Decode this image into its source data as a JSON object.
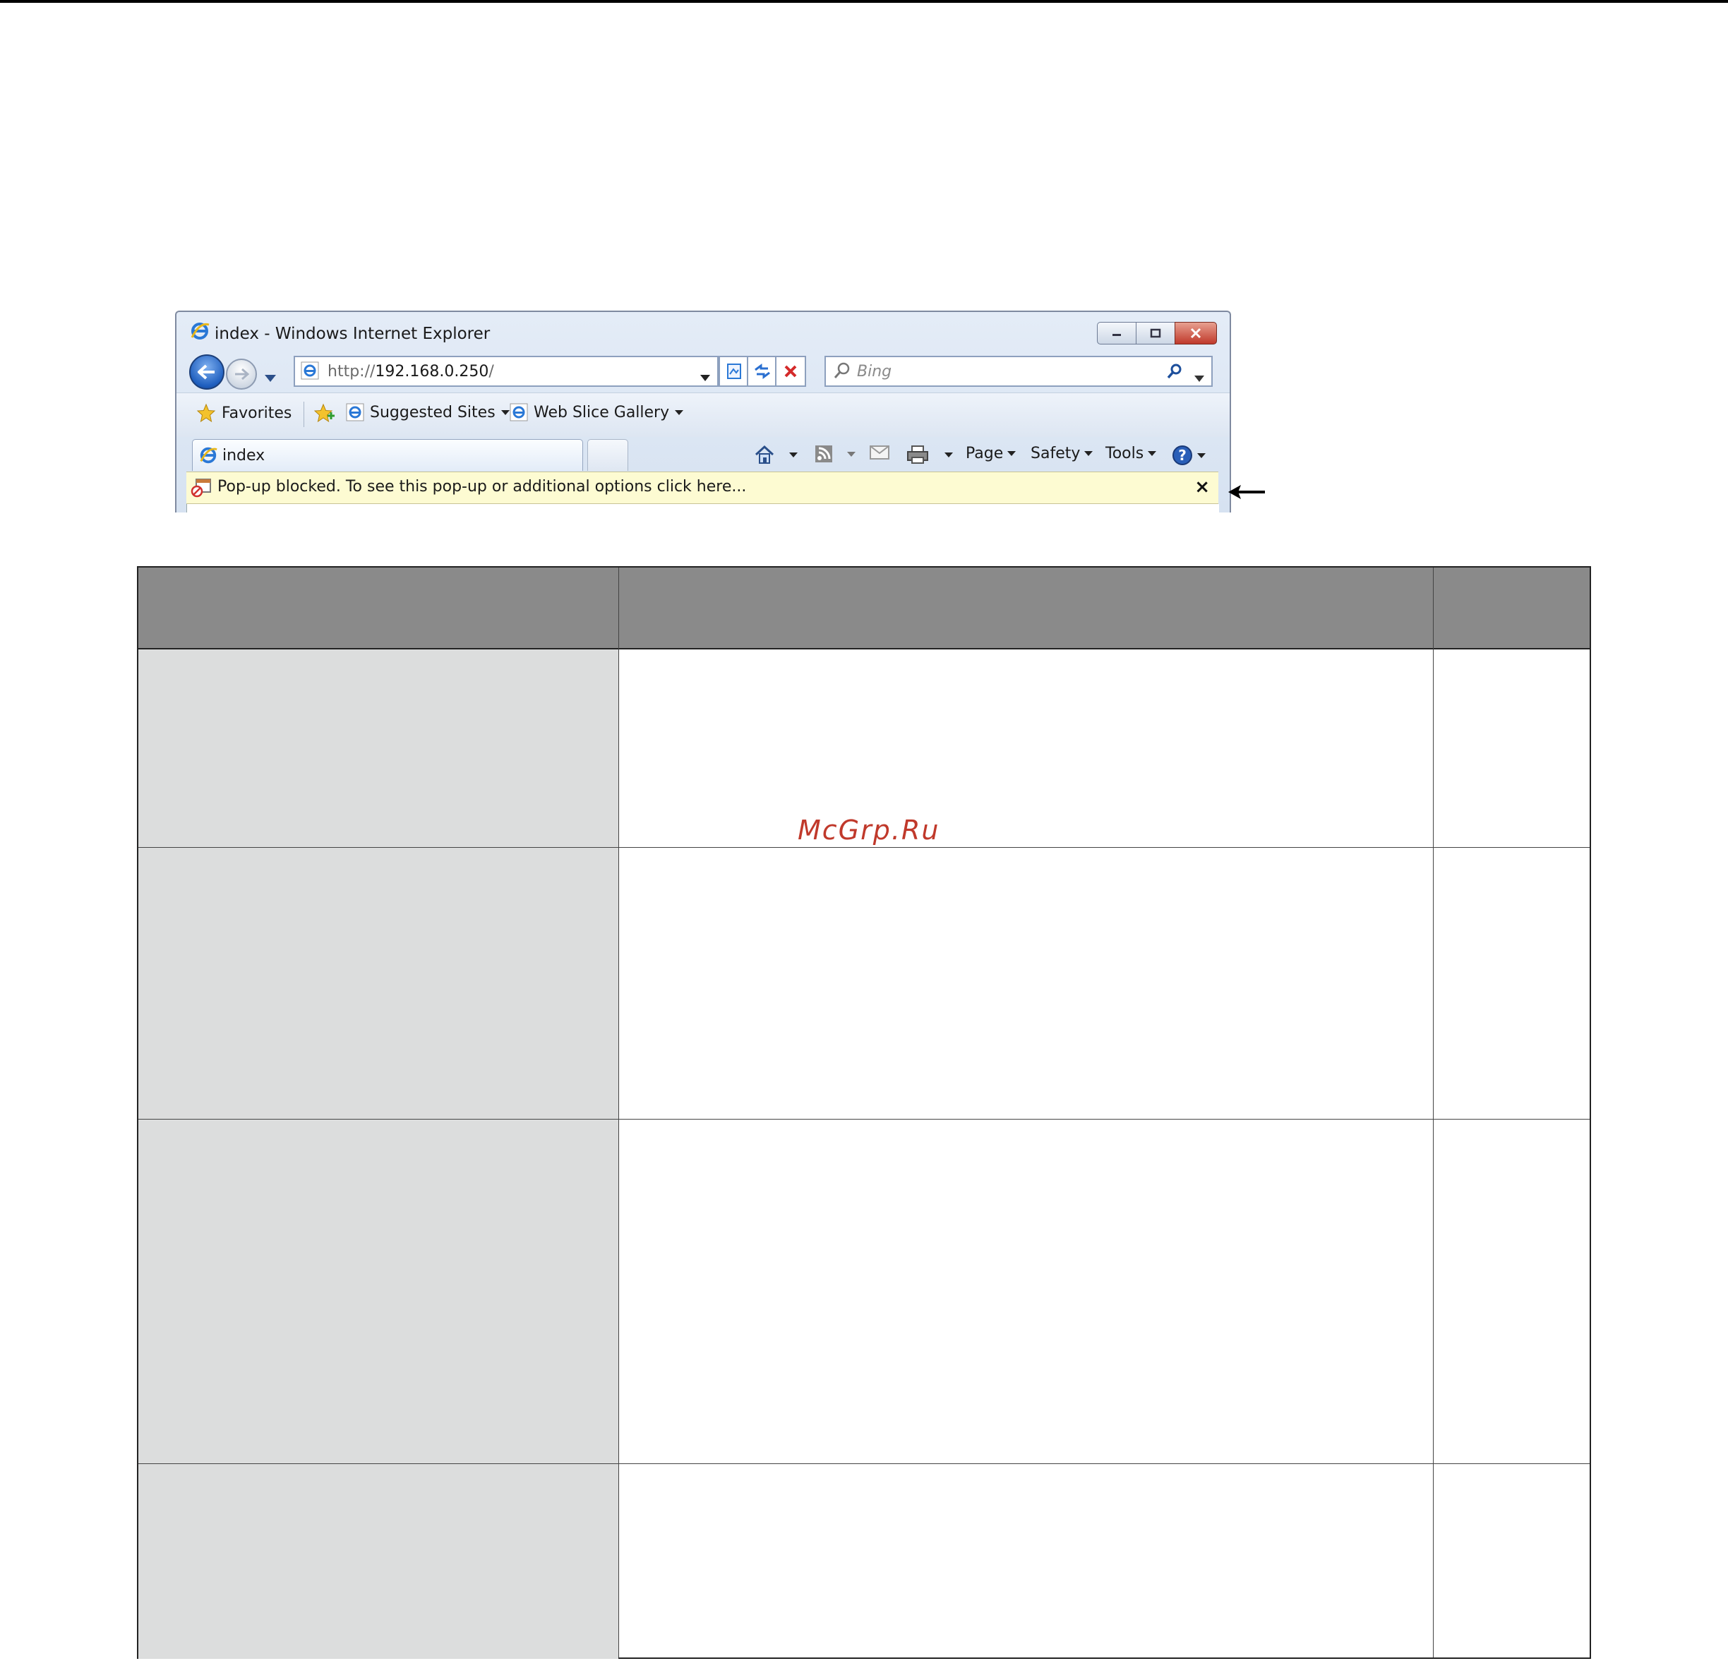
{
  "window": {
    "title": "index - Windows Internet Explorer",
    "address": {
      "prefix": "http://",
      "host": "192.168.0.250",
      "suffix": "/"
    },
    "search": {
      "placeholder": "Bing"
    },
    "favorites_bar": {
      "favorites_label": "Favorites",
      "items": [
        "Suggested Sites",
        "Web Slice Gallery"
      ]
    },
    "tab": {
      "label": "index"
    },
    "command_bar": {
      "page": "Page",
      "safety": "Safety",
      "tools": "Tools"
    },
    "infobar": {
      "message": "Pop-up blocked. To see this pop-up or additional options click here...",
      "close_label": "×"
    }
  },
  "watermark": "McGrp.Ru",
  "icons": {
    "ie": "ie-logo-icon",
    "back": "back-arrow-icon",
    "forward": "forward-arrow-icon",
    "compat": "compatibility-view-icon",
    "refresh": "refresh-icon",
    "stop": "stop-icon",
    "search": "magnifier-icon",
    "star": "star-icon",
    "add_fav": "add-favorite-icon",
    "home": "home-icon",
    "feed": "rss-feed-icon",
    "mail": "mail-icon",
    "print": "print-icon",
    "help": "help-icon",
    "popup": "popup-blocked-icon",
    "annotation_arrow": "annotation-arrow-icon"
  },
  "colors": {
    "header_gray": "#8a8a8a",
    "label_gray": "#dcdddd",
    "infobar_yellow": "#fdfbd2",
    "watermark_red": "#c0392b"
  }
}
